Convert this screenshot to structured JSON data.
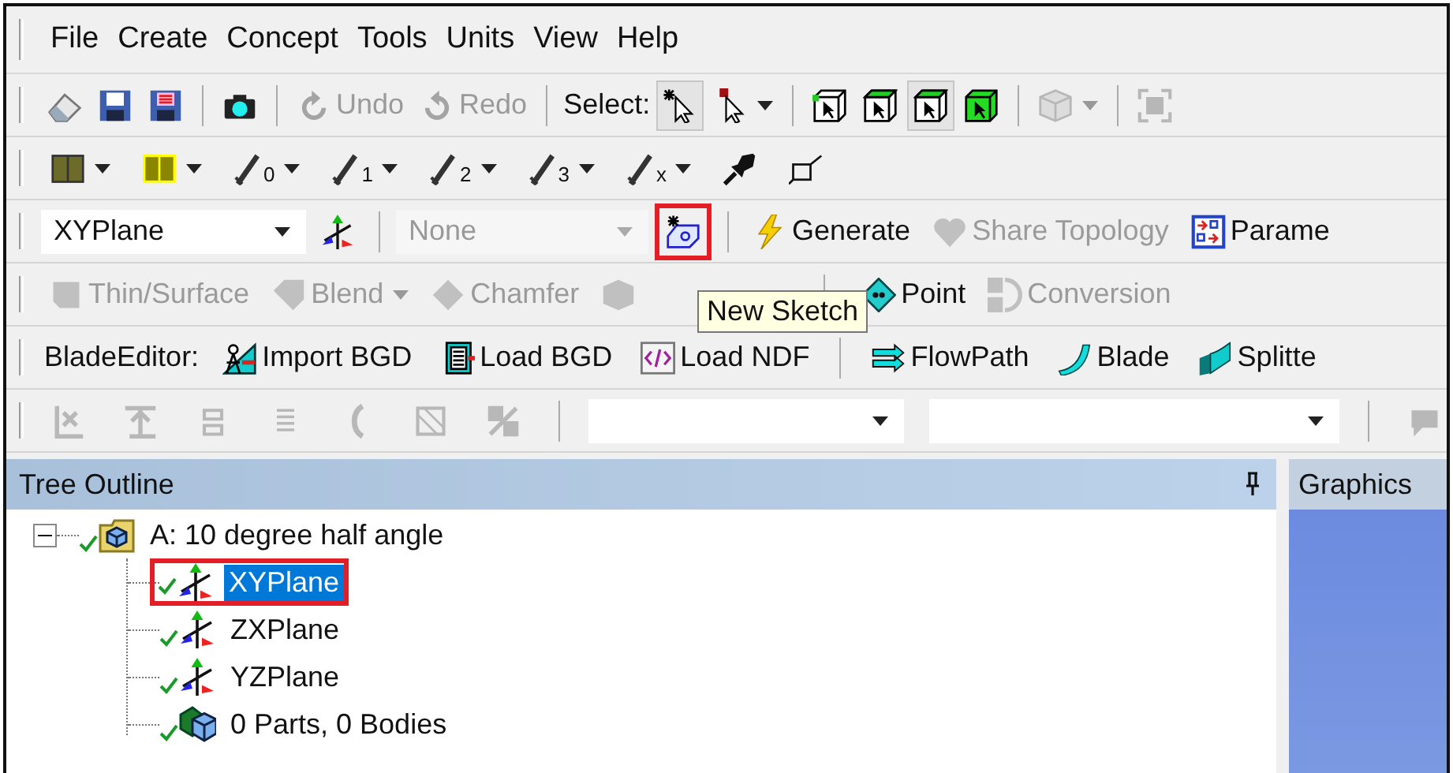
{
  "menu": [
    {
      "label": "File"
    },
    {
      "label": "Create"
    },
    {
      "label": "Concept"
    },
    {
      "label": "Tools"
    },
    {
      "label": "Units"
    },
    {
      "label": "View"
    },
    {
      "label": "Help"
    }
  ],
  "toolbars": [
    {
      "items": [
        {
          "kind": "icon"
        },
        {
          "kind": "icon"
        },
        {
          "kind": "icon"
        },
        {
          "kind": "separator"
        },
        {
          "kind": "icon"
        },
        {
          "kind": "separator"
        },
        {
          "kind": "button",
          "label": "Undo",
          "disabled": true
        },
        {
          "kind": "button",
          "label": "Redo",
          "disabled": true
        },
        {
          "kind": "separator"
        },
        {
          "kind": "label",
          "label": "Select:"
        },
        {
          "kind": "icon",
          "selected": true
        },
        {
          "kind": "icon",
          "selected": false,
          "dropdown": true
        },
        {
          "kind": "separator"
        },
        {
          "kind": "icon",
          "selected": false
        },
        {
          "kind": "icon",
          "selected": false
        },
        {
          "kind": "icon",
          "selected": true
        },
        {
          "kind": "icon",
          "selected": false
        },
        {
          "kind": "separator"
        },
        {
          "kind": "icon",
          "disabled": true,
          "dropdown": true
        },
        {
          "kind": "separator"
        },
        {
          "kind": "icon",
          "disabled": true
        }
      ]
    },
    {
      "items": [
        {
          "kind": "icon",
          "dropdown": true
        },
        {
          "kind": "icon",
          "dropdown": true
        },
        {
          "kind": "tool",
          "label": "0",
          "dropdown": true
        },
        {
          "kind": "tool",
          "label": "1",
          "dropdown": true
        },
        {
          "kind": "tool",
          "label": "2",
          "dropdown": true
        },
        {
          "kind": "tool",
          "label": "3",
          "dropdown": true
        },
        {
          "kind": "tool",
          "label": "x",
          "dropdown": true
        },
        {
          "kind": "icon"
        },
        {
          "kind": "icon"
        }
      ]
    },
    {
      "items": [
        {
          "kind": "combo",
          "value": "XYPlane"
        },
        {
          "kind": "icon"
        },
        {
          "kind": "separator"
        },
        {
          "kind": "combo",
          "value": "None",
          "disabled": true
        },
        {
          "kind": "icon",
          "highlighted": true,
          "tooltip": "New Sketch"
        },
        {
          "kind": "separator"
        },
        {
          "kind": "button",
          "label": "Generate"
        },
        {
          "kind": "button",
          "label": "Share Topology",
          "disabled": true
        },
        {
          "kind": "button",
          "label": "Parame"
        }
      ]
    },
    {
      "items": [
        {
          "kind": "button",
          "label": "Thin/Surface",
          "disabled": true
        },
        {
          "kind": "button",
          "label": "Blend",
          "disabled": true,
          "dropdown": true
        },
        {
          "kind": "button",
          "label": "Chamfer",
          "disabled": true
        },
        {
          "kind": "icon",
          "disabled": true
        },
        {
          "kind": "separator"
        },
        {
          "kind": "button",
          "label": "Point"
        },
        {
          "kind": "button",
          "label": "Conversion",
          "disabled": true
        }
      ]
    },
    {
      "items": [
        {
          "kind": "label",
          "label": "BladeEditor:"
        },
        {
          "kind": "button",
          "label": "Import BGD"
        },
        {
          "kind": "button",
          "label": "Load BGD"
        },
        {
          "kind": "button",
          "label": "Load NDF"
        },
        {
          "kind": "separator"
        },
        {
          "kind": "button",
          "label": "FlowPath"
        },
        {
          "kind": "button",
          "label": "Blade"
        },
        {
          "kind": "button",
          "label": "Splitte"
        }
      ]
    },
    {
      "items": [
        {
          "kind": "icon",
          "disabled": true
        },
        {
          "kind": "icon",
          "disabled": true
        },
        {
          "kind": "icon",
          "disabled": true
        },
        {
          "kind": "icon",
          "disabled": true
        },
        {
          "kind": "icon",
          "disabled": true
        },
        {
          "kind": "icon",
          "disabled": true
        },
        {
          "kind": "icon",
          "disabled": true
        },
        {
          "kind": "separator"
        },
        {
          "kind": "combo"
        },
        {
          "kind": "combo"
        },
        {
          "kind": "separator"
        },
        {
          "kind": "icon",
          "disabled": true
        }
      ]
    }
  ],
  "tree_panel": {
    "title": "Tree Outline"
  },
  "graphics_panel": {
    "title": "Graphics"
  },
  "tree": [
    {
      "label": "A: 10 degree half angle",
      "kind": "root",
      "expanded": true,
      "selected": false,
      "children": [
        {
          "label": "XYPlane",
          "kind": "plane",
          "selected": true,
          "highlighted": true
        },
        {
          "label": "ZXPlane",
          "kind": "plane",
          "selected": false
        },
        {
          "label": "YZPlane",
          "kind": "plane",
          "selected": false
        },
        {
          "label": "0 Parts, 0 Bodies",
          "kind": "parts",
          "selected": false
        }
      ]
    }
  ]
}
